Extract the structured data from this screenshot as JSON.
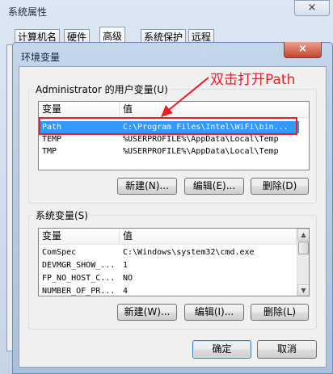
{
  "background_window": {
    "title": "系统属性",
    "close": "×",
    "tabs": [
      "计算机名",
      "硬件",
      "高级",
      "系统保护",
      "远程"
    ],
    "selected_tab": "高级"
  },
  "dialog": {
    "title": "环境变量",
    "close": "×",
    "user_group": {
      "title": "Administrator 的用户变量(U)",
      "columns": [
        "变量",
        "值"
      ],
      "rows": [
        {
          "name": "Path",
          "value": "C:\\Program Files\\Intel\\WiFi\\bin..."
        },
        {
          "name": "TEMP",
          "value": "%USERPROFILE%\\AppData\\Local\\Temp"
        },
        {
          "name": "TMP",
          "value": "%USERPROFILE%\\AppData\\Local\\Temp"
        }
      ],
      "selected_row": "Path",
      "buttons": {
        "new": "新建(N)...",
        "edit": "编辑(E)...",
        "delete": "删除(D)"
      }
    },
    "system_group": {
      "title": "系统变量(S)",
      "columns": [
        "变量",
        "值"
      ],
      "rows": [
        {
          "name": "ComSpec",
          "value": "C:\\Windows\\system32\\cmd.exe"
        },
        {
          "name": "DEVMGR_SHOW_...",
          "value": "1"
        },
        {
          "name": "FP_NO_HOST_C...",
          "value": "NO"
        },
        {
          "name": "NUMBER_OF_PR...",
          "value": "4"
        }
      ],
      "buttons": {
        "new": "新建(W)...",
        "edit": "编辑(I)...",
        "delete": "删除(L)"
      }
    },
    "ok": "确定",
    "cancel": "取消"
  },
  "annotation": {
    "text": "双击打开Path",
    "color": "#ee1c24"
  },
  "colors": {
    "selection": "#3399ff",
    "annotation": "#ee1c24"
  }
}
